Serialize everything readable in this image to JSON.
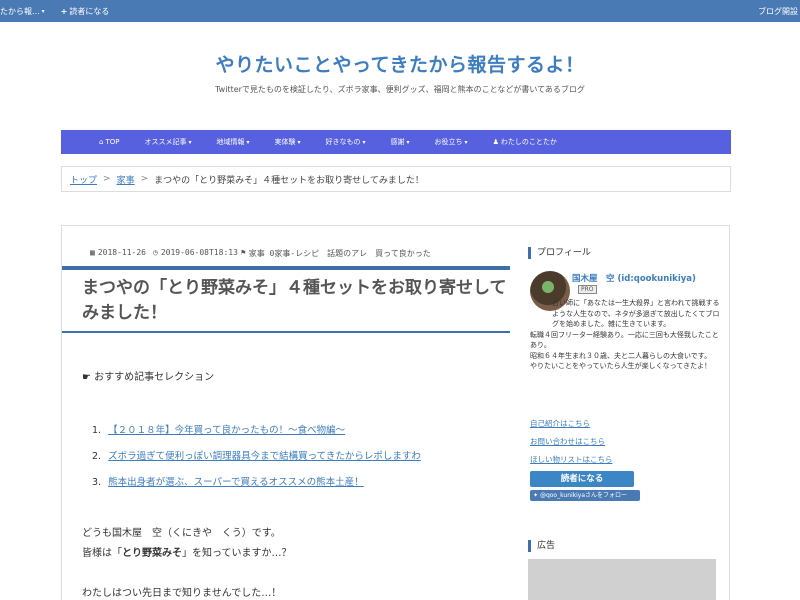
{
  "topbar": {
    "left_item": "たから報...",
    "reader_label": "読者になる",
    "right_item": "ブログ開設"
  },
  "header": {
    "title": "やりたいことやってきたから報告するよ！",
    "description": "Twitterで見たものを検証したり、ズボラ家事、便利グッズ、福岡と熊本のことなどが書いてあるブログ"
  },
  "nav": {
    "items": [
      {
        "label": "TOP",
        "icon": "home-icon",
        "dropdown": false
      },
      {
        "label": "オススメ記事",
        "icon": "",
        "dropdown": true
      },
      {
        "label": "地域情報",
        "icon": "",
        "dropdown": true
      },
      {
        "label": "実体験",
        "icon": "",
        "dropdown": true
      },
      {
        "label": "好きなもの",
        "icon": "",
        "dropdown": true
      },
      {
        "label": "感謝",
        "icon": "",
        "dropdown": true
      },
      {
        "label": "お役立ち",
        "icon": "",
        "dropdown": true
      },
      {
        "label": "わたしのことたか",
        "icon": "user-icon",
        "dropdown": false
      }
    ]
  },
  "breadcrumb": {
    "items": [
      "トップ",
      "家事",
      "まつやの「とり野菜みそ」４種セットをお取り寄せしてみました！"
    ]
  },
  "article": {
    "date_published": "2018-11-26",
    "date_updated": "2019-06-08T18:13",
    "categories": "家事 0家事-レシピ　話題のアレ　買って良かった",
    "title": "まつやの「とり野菜みそ」４種セットをお取り寄せしてみました！",
    "rec_heading": "おすすめ記事セレクション",
    "recommendations": [
      {
        "num": "1.",
        "text": "【２０１８年】今年買って良かったもの！～食べ物編～"
      },
      {
        "num": "2.",
        "text": "ズボラ過ぎて便利っぽい調理器具今まで結構買ってきたからレポしますわ"
      },
      {
        "num": "3.",
        "text": "熊本出身者が選ぶ、スーパーで買えるオススメの熊本土産！"
      }
    ],
    "body_line1": "どうも国木屋　空（くにきや　くう）です。",
    "body_line2_pre": "皆様は「",
    "body_line2_bold": "とり野菜みそ",
    "body_line2_post": "」を知っていますか…？",
    "body_line3": "わたしはつい先日まで知りませんでした…！"
  },
  "sidebar": {
    "profile_heading": "プロフィール",
    "author": "国木屋　空 (id:qookunikiya)",
    "pro_badge": "PRO",
    "bio": [
      "占い師に「あなたは一生大殺界」と言われて挑戦するような人生なので、ネタが多過ぎて放出したくてブログを始めました。雑に生きています。",
      "転職４回フリーター経験あり。一応に三回も大怪我したことあり。",
      "昭和６４年生まれ３０歳、夫と二人暮らしの大食いです。",
      "やりたいことをやっていたら人生が楽しくなってきたよ！"
    ],
    "links": [
      "自己紹介はこちら",
      "お問い合わせはこちら",
      "ほしい物リストはこちら"
    ],
    "reader_button": "読者になる",
    "follow_button": "@qoo_kunikiyaさんをフォロー",
    "ad_heading": "広告"
  },
  "colors": {
    "topbar": "#4a7ab3",
    "title": "#3d7dc0",
    "nav": "#5761e0",
    "accent": "#3d6fa8"
  }
}
